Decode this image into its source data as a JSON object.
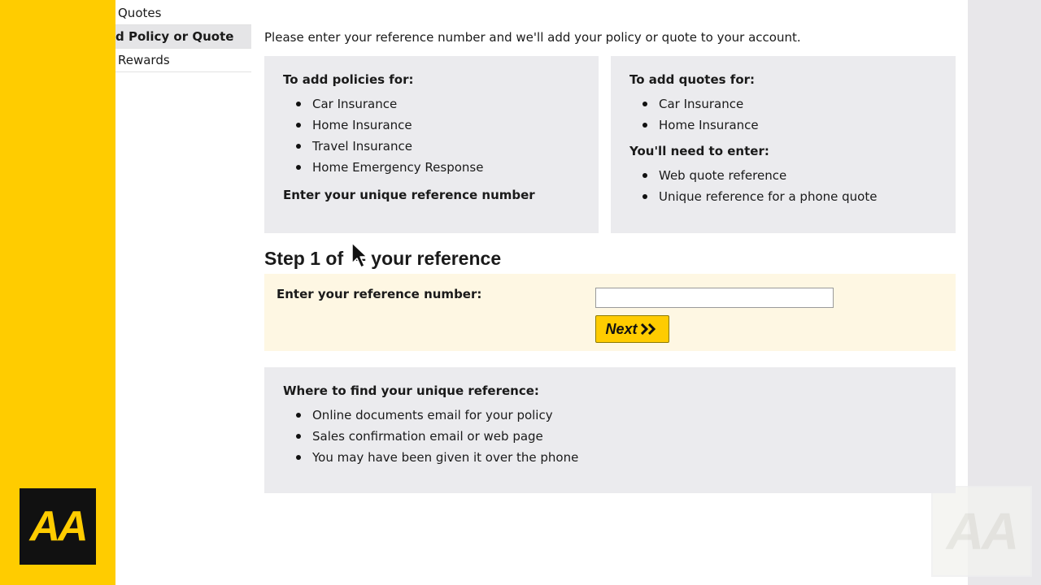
{
  "nav": {
    "items": [
      {
        "label": "Quotes"
      },
      {
        "label": "d Policy or Quote"
      },
      {
        "label": "Rewards"
      }
    ]
  },
  "intro_text": "Please enter your reference number and we'll add your policy or quote to your account.",
  "policies_panel": {
    "heading": "To add policies for:",
    "items": [
      "Car Insurance",
      "Home Insurance",
      "Travel Insurance",
      "Home Emergency Response"
    ],
    "footer": "Enter your unique reference number"
  },
  "quotes_panel": {
    "heading": "To add quotes for:",
    "items": [
      "Car Insurance",
      "Home Insurance"
    ],
    "subheading": "You'll need to enter:",
    "enter_items": [
      "Web quote reference",
      "Unique reference for a phone quote"
    ]
  },
  "step": {
    "title": "Step 1 of",
    "title_suffix": "– your reference"
  },
  "reference_form": {
    "label": "Enter your reference number:",
    "value": "",
    "next_label": "Next",
    "next_icon": "double-chevron-right-icon"
  },
  "find_panel": {
    "heading": "Where to find your unique reference:",
    "items": [
      "Online documents email for your policy",
      "Sales confirmation email or web page",
      "You may have been given it over the phone"
    ]
  },
  "branding": {
    "logo_text": "AA",
    "brand_color": "#ffcc00",
    "logo_bg": "#111111"
  }
}
